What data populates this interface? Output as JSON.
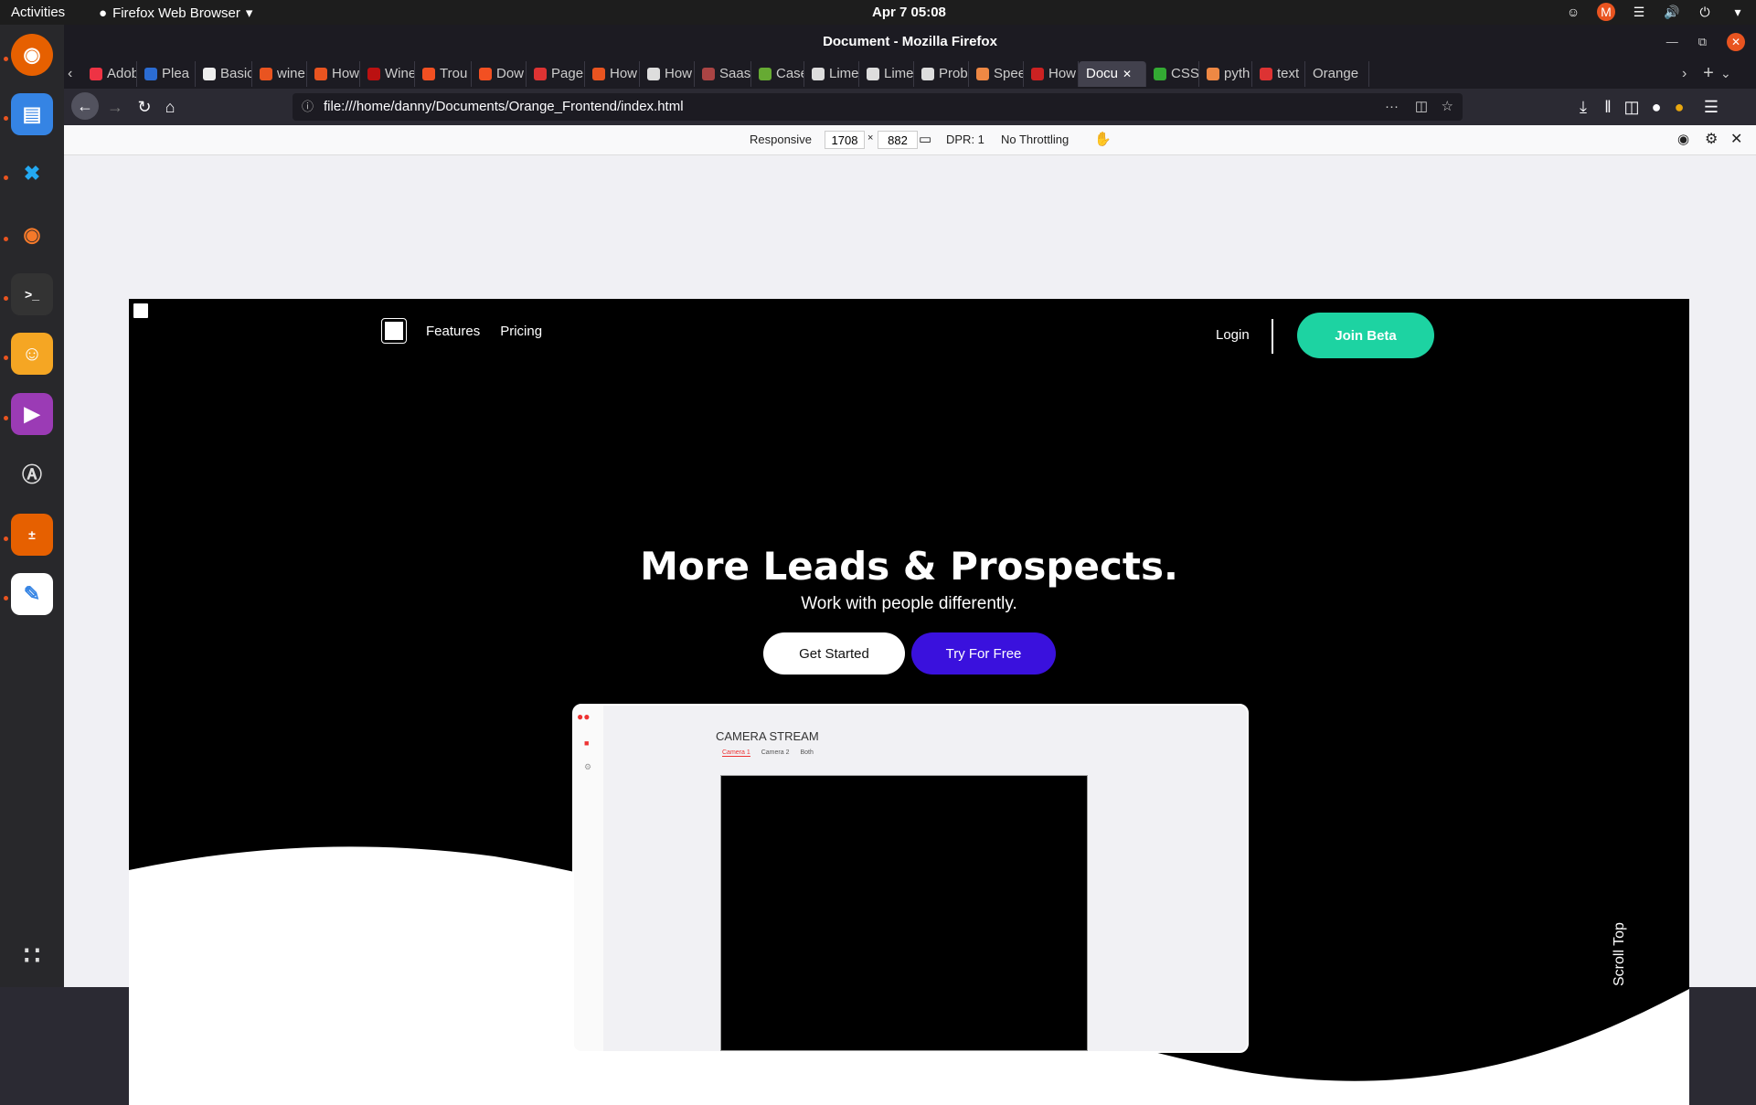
{
  "topbar": {
    "activities": "Activities",
    "app_name": "Firefox Web Browser",
    "clock": "Apr 7  05:08"
  },
  "window": {
    "title": "Document - Mozilla Firefox"
  },
  "tabs": [
    {
      "label": "Adob",
      "color": "#e34"
    },
    {
      "label": "Plea",
      "color": "#2b6cd3"
    },
    {
      "label": "Basic",
      "color": "#eee"
    },
    {
      "label": "wine",
      "color": "#e95420"
    },
    {
      "label": "How",
      "color": "#e95420"
    },
    {
      "label": "Wine",
      "color": "#b11"
    },
    {
      "label": "Trou",
      "color": "#f25022"
    },
    {
      "label": "Dow",
      "color": "#f25022"
    },
    {
      "label": "Page",
      "color": "#d33"
    },
    {
      "label": "How",
      "color": "#e95420"
    },
    {
      "label": "How",
      "color": "#ddd"
    },
    {
      "label": "Saas",
      "color": "#a44"
    },
    {
      "label": "Case",
      "color": "#6a3"
    },
    {
      "label": "Lime",
      "color": "#ddd"
    },
    {
      "label": "Lime",
      "color": "#ddd"
    },
    {
      "label": "Prob",
      "color": "#ddd"
    },
    {
      "label": "Spee",
      "color": "#e84"
    },
    {
      "label": "How",
      "color": "#c22"
    },
    {
      "label": "Docu",
      "color": "",
      "active": true
    },
    {
      "label": "CSS",
      "color": "#3a3"
    },
    {
      "label": "pyth",
      "color": "#e84"
    },
    {
      "label": "text",
      "color": "#d33"
    },
    {
      "label": "Orange",
      "color": ""
    }
  ],
  "navbar": {
    "url": "file:///home/danny/Documents/Orange_Frontend/index.html"
  },
  "rdm": {
    "device": "Responsive",
    "width": "1708",
    "height": "882",
    "dpr": "DPR: 1",
    "throttling": "No Throttling"
  },
  "page": {
    "nav": {
      "features": "Features",
      "pricing": "Pricing",
      "login": "Login",
      "join": "Join Beta"
    },
    "hero": {
      "title": "More Leads & Prospects.",
      "subtitle": "Work with people differently.",
      "primary_cta": "Get Started",
      "secondary_cta": "Try For Free"
    },
    "preview": {
      "title": "CAMERA STREAM",
      "tabs": [
        "Camera 1",
        "Camera 2",
        "Both"
      ]
    },
    "scroll_top": "Scroll Top"
  },
  "colors": {
    "accent_green": "#1dd3a2",
    "accent_purple": "#3a11dd",
    "ubuntu_orange": "#e95420"
  }
}
